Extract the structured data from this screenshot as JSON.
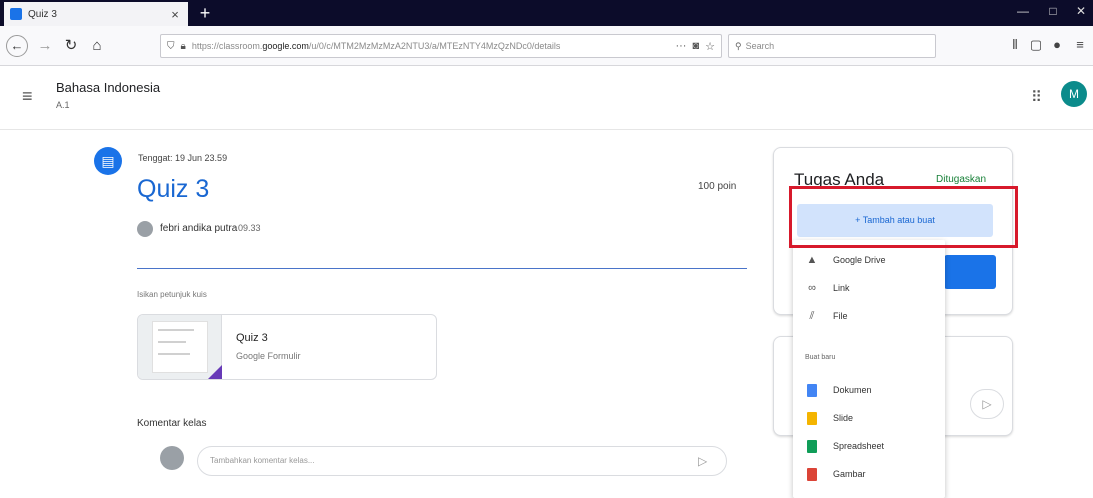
{
  "browser": {
    "tab_title": "Quiz 3",
    "new_tab_symbol": "+",
    "url_prefix": "https://classroom.",
    "url_domain": "google.com",
    "url_rest": "/u/0/c/MTM2MzMzMzA2NTU3/a/MTEzNTY4MzQzNDc0/details",
    "search_placeholder": "Search",
    "more_label": "···",
    "window_controls": [
      "—",
      "□",
      "✕"
    ]
  },
  "header": {
    "class_name": "Bahasa Indonesia",
    "class_section": "A.1",
    "avatar_letter": "M"
  },
  "assignment": {
    "due": "Tenggat: 19 Jun 23.59",
    "title": "Quiz 3",
    "points": "100 poin",
    "author": "febri andika putra",
    "time": "09.33",
    "instructions": "Isikan petunjuk kuis",
    "attachment": {
      "title": "Quiz 3",
      "subtitle": "Google Formulir"
    }
  },
  "comments": {
    "label": "Komentar kelas",
    "placeholder": "Tambahkan komentar kelas..."
  },
  "your_work": {
    "title": "Tugas Anda",
    "status": "Ditugaskan",
    "add_button": "+  Tambah atau buat"
  },
  "add_menu": {
    "items": [
      {
        "label": "Google Drive",
        "icon": "google-drive-icon"
      },
      {
        "label": "Link",
        "icon": "link-icon"
      },
      {
        "label": "File",
        "icon": "paperclip-icon"
      }
    ],
    "create_label": "Buat baru",
    "create_items": [
      {
        "label": "Dokumen",
        "icon": "docs-icon",
        "color": "#4285f4"
      },
      {
        "label": "Slide",
        "icon": "slides-icon",
        "color": "#f4b400"
      },
      {
        "label": "Spreadsheet",
        "icon": "sheets-icon",
        "color": "#0f9d58"
      },
      {
        "label": "Gambar",
        "icon": "drawings-icon",
        "color": "#db4437"
      }
    ]
  },
  "colors": {
    "accent": "#1a73e8",
    "title_blue": "#1967d2",
    "status_green": "#188038",
    "highlight_red": "#d7192b"
  }
}
